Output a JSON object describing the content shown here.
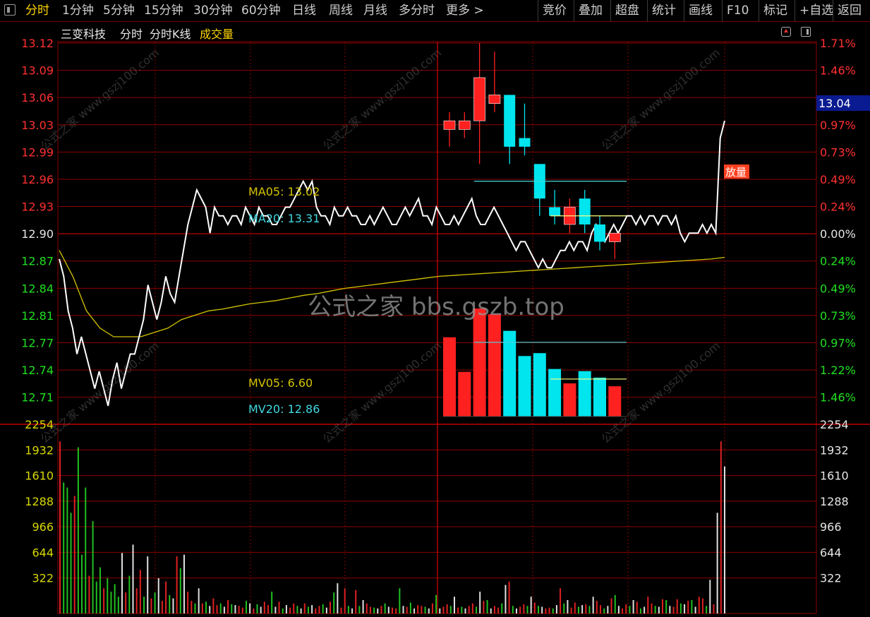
{
  "toolbar": {
    "left": [
      "分时",
      "1分钟",
      "5分钟",
      "15分钟",
      "30分钟",
      "60分钟",
      "日线",
      "周线",
      "月线",
      "多分时",
      "更多 >"
    ],
    "right": [
      "竞价",
      "叠加",
      "超盘",
      "统计",
      "画线",
      "F10",
      "标记",
      "+自选",
      "返回"
    ],
    "active": "分时"
  },
  "header": {
    "stock_name": "三变科技",
    "mode": "分时",
    "kline": "分时K线",
    "volume": "成交量"
  },
  "price_axis": {
    "left": [
      "13.12",
      "13.09",
      "13.06",
      "13.03",
      "12.99",
      "12.96",
      "12.93",
      "12.90",
      "12.87",
      "12.84",
      "12.81",
      "12.77",
      "12.74",
      "12.71"
    ],
    "right": [
      "1.71%",
      "1.46%",
      "",
      "0.97%",
      "0.73%",
      "0.49%",
      "0.24%",
      "0.00%",
      "0.24%",
      "0.49%",
      "0.73%",
      "0.97%",
      "1.22%",
      "1.46%"
    ],
    "current_price": "13.04"
  },
  "volume_axis": {
    "labels": [
      "2254",
      "1932",
      "1610",
      "1288",
      "966",
      "644",
      "322"
    ]
  },
  "overlay": {
    "ma05": "MA05: 13.02",
    "ma20": "MA20: 13.31",
    "mv05": "MV05: 6.60",
    "mv20": "MV20: 12.86",
    "badge": "放量",
    "watermark": "公式之家 bbs.gszb.top",
    "watermark_small": "公式之家  www.gszj100.com"
  },
  "colors": {
    "up": "#ff2020",
    "down": "#00e5ee",
    "vol_up": "#e02020",
    "vol_down": "#20c020",
    "vol_flat": "#e0e0e0",
    "price_line": "#ffffff",
    "avg_line": "#d4c400",
    "grid": "#8b0000",
    "axis_red": "#ff3030",
    "axis_green": "#20e020",
    "axis_yellow": "#d8d800",
    "ma20_color": "#40d8e0"
  },
  "chart_data": {
    "type": "line",
    "price_range": [
      12.7,
      13.13
    ],
    "price_series": [
      12.87,
      12.85,
      12.81,
      12.79,
      12.76,
      12.78,
      12.76,
      12.74,
      12.72,
      12.74,
      12.72,
      12.7,
      12.73,
      12.75,
      12.72,
      12.74,
      12.76,
      12.76,
      12.78,
      12.8,
      12.84,
      12.82,
      12.8,
      12.82,
      12.85,
      12.83,
      12.82,
      12.85,
      12.88,
      12.91,
      12.93,
      12.95,
      12.94,
      12.93,
      12.9,
      12.93,
      12.92,
      12.92,
      12.91,
      12.92,
      12.92,
      12.91,
      12.93,
      12.92,
      12.91,
      12.93,
      12.92,
      12.92,
      12.91,
      12.91,
      12.92,
      12.93,
      12.93,
      12.94,
      12.95,
      12.96,
      12.95,
      12.96,
      12.93,
      12.92,
      12.92,
      12.91,
      12.93,
      12.92,
      12.92,
      12.93,
      12.92,
      12.92,
      12.91,
      12.91,
      12.92,
      12.91,
      12.92,
      12.93,
      12.92,
      12.91,
      12.91,
      12.92,
      12.93,
      12.92,
      12.93,
      12.94,
      12.92,
      12.92,
      12.91,
      12.93,
      12.92,
      12.91,
      12.91,
      12.92,
      12.91,
      12.92,
      12.93,
      12.94,
      12.92,
      12.91,
      12.91,
      12.92,
      12.93,
      12.92,
      12.91,
      12.9,
      12.89,
      12.88,
      12.89,
      12.89,
      12.88,
      12.87,
      12.86,
      12.87,
      12.86,
      12.86,
      12.87,
      12.88,
      12.88,
      12.89,
      12.88,
      12.89,
      12.89,
      12.88,
      12.9,
      12.91,
      12.9,
      12.89,
      12.9,
      12.91,
      12.9,
      12.91,
      12.92,
      12.92,
      12.91,
      12.92,
      12.91,
      12.92,
      12.92,
      12.91,
      12.92,
      12.92,
      12.91,
      12.92,
      12.9,
      12.89,
      12.9,
      12.9,
      12.9,
      12.91,
      12.9,
      12.91,
      12.9,
      13.01,
      13.03
    ],
    "avg_series": [
      12.88,
      12.85,
      12.81,
      12.79,
      12.78,
      12.78,
      12.78,
      12.785,
      12.79,
      12.8,
      12.805,
      12.81,
      12.812,
      12.815,
      12.818,
      12.82,
      12.822,
      12.825,
      12.828,
      12.83,
      12.833,
      12.836,
      12.838,
      12.84,
      12.842,
      12.844,
      12.846,
      12.848,
      12.85,
      12.851,
      12.852,
      12.853,
      12.854,
      12.855,
      12.856,
      12.857,
      12.858,
      12.859,
      12.86,
      12.861,
      12.862,
      12.863,
      12.864,
      12.865,
      12.866,
      12.867,
      12.868,
      12.869,
      12.87,
      12.872
    ],
    "candles": [
      {
        "o": 13.02,
        "h": 13.04,
        "l": 13.0,
        "c": 13.03
      },
      {
        "o": 13.02,
        "h": 13.04,
        "l": 13.01,
        "c": 13.03
      },
      {
        "o": 13.03,
        "h": 13.12,
        "l": 12.98,
        "c": 13.08
      },
      {
        "o": 13.05,
        "h": 13.11,
        "l": 13.04,
        "c": 13.06
      },
      {
        "o": 13.06,
        "h": 13.06,
        "l": 12.98,
        "c": 13.0
      },
      {
        "o": 13.01,
        "h": 13.05,
        "l": 12.99,
        "c": 13.0
      },
      {
        "o": 12.98,
        "h": 12.98,
        "l": 12.92,
        "c": 12.94
      },
      {
        "o": 12.93,
        "h": 12.95,
        "l": 12.91,
        "c": 12.92
      },
      {
        "o": 12.91,
        "h": 12.94,
        "l": 12.9,
        "c": 12.93
      },
      {
        "o": 12.94,
        "h": 12.95,
        "l": 12.9,
        "c": 12.91
      },
      {
        "o": 12.91,
        "h": 12.92,
        "l": 12.88,
        "c": 12.89
      },
      {
        "o": 12.89,
        "h": 12.9,
        "l": 12.87,
        "c": 12.9
      }
    ],
    "candle_volumes": [
      11.0,
      6.2,
      15.0,
      14.2,
      11.9,
      8.4,
      8.8,
      6.6,
      4.6,
      6.3,
      5.4,
      4.2
    ],
    "ma_levels": {
      "ma_a": 12.96,
      "ma_b": 12.92,
      "mv_a": 10.3,
      "mv_b": 5.2
    },
    "volume_max": 2254
  }
}
